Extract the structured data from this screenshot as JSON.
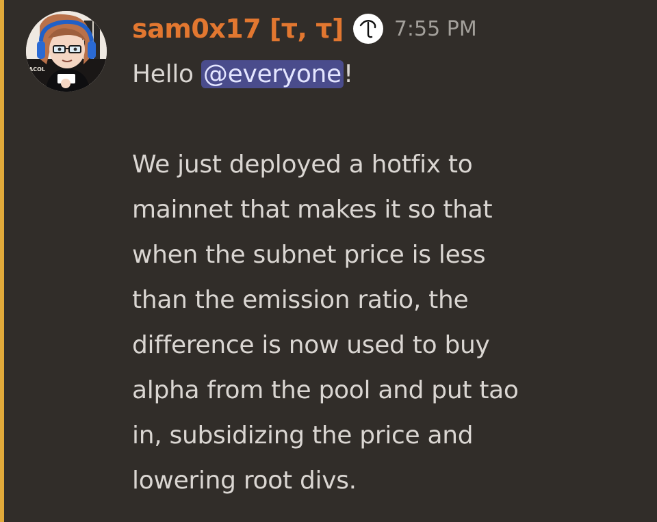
{
  "message": {
    "author": "sam0x17 [τ, τ]",
    "timestamp": "7:55 PM",
    "greeting_prefix": "Hello ",
    "mention": "@everyone",
    "greeting_suffix": "!",
    "body_lines": [
      "We just deployed a hotfix to",
      "mainnet that makes it so that",
      "when the subnet price is less",
      "than the emission ratio, the",
      "difference is now used to buy",
      "alpha from the pool and put tao",
      "in, subsidizing the price and",
      "lowering root divs."
    ]
  },
  "avatar_text": "ACOL",
  "colors": {
    "background": "#312d29",
    "mention_bar": "#e0a93a",
    "username": "#e27730",
    "mention_bg": "#4a4c8c",
    "text": "#dad6d2",
    "timestamp": "#a3a09b"
  },
  "icons": {
    "role_icon": "tau-role-icon"
  }
}
